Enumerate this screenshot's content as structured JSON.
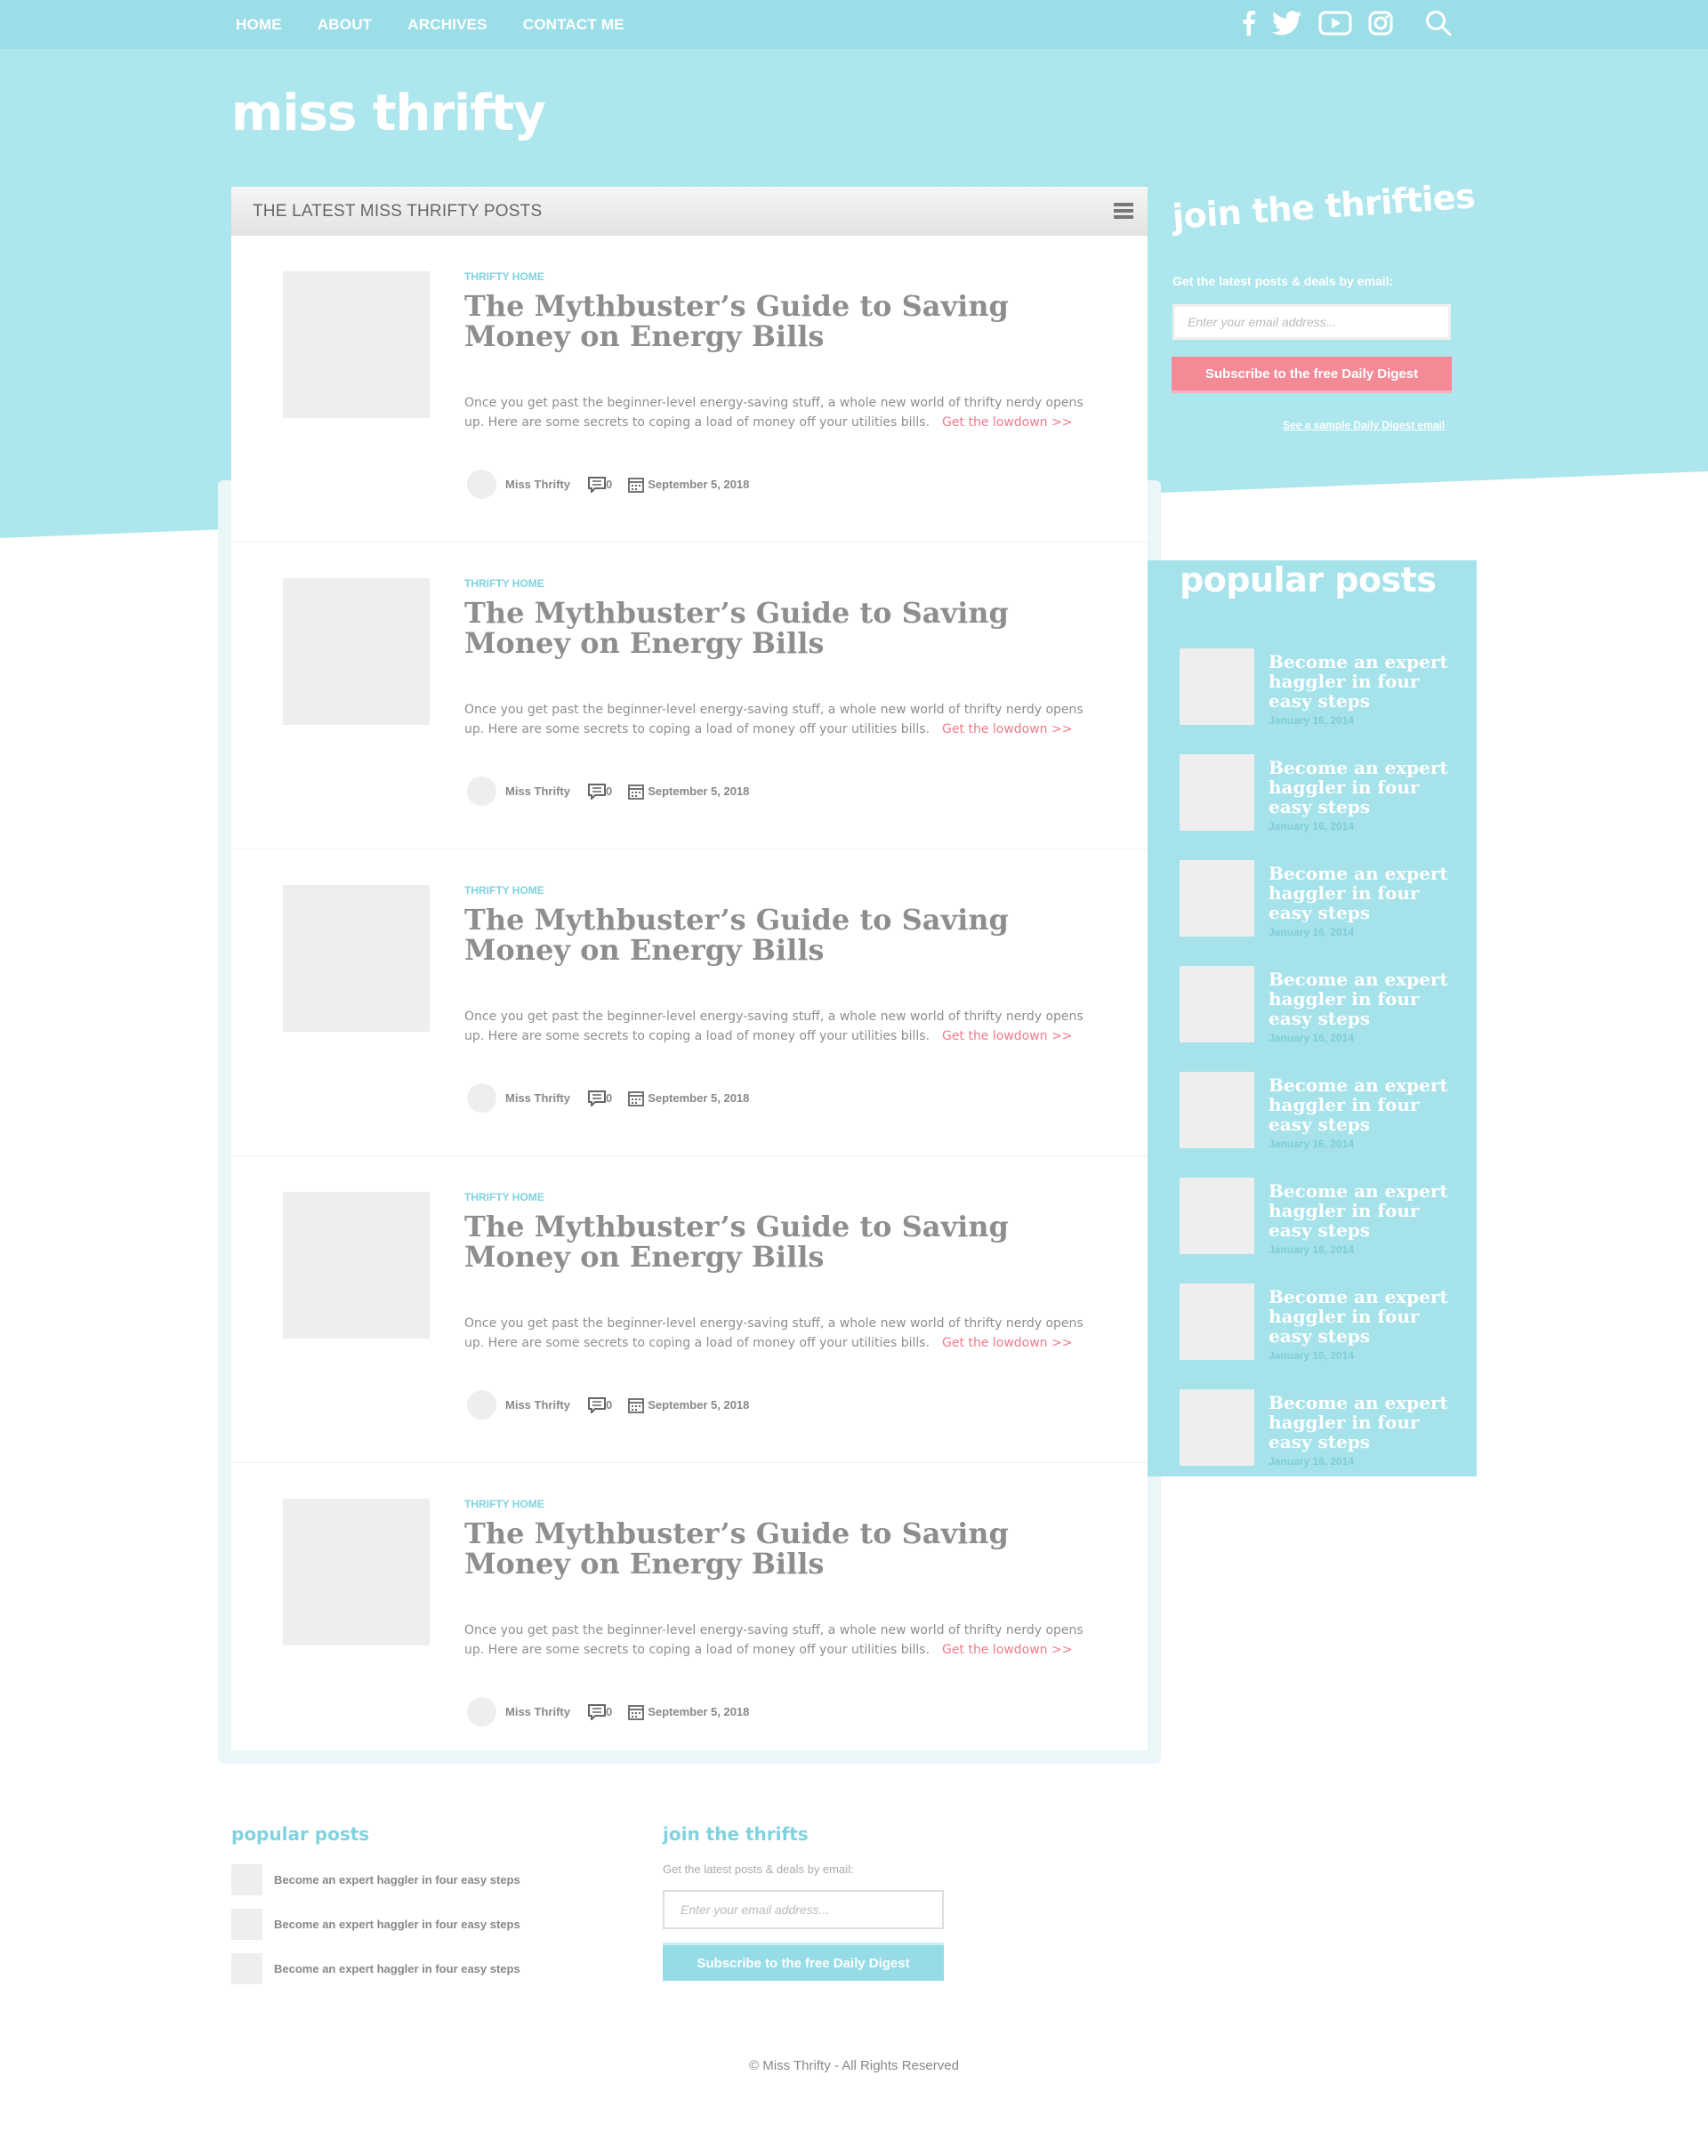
{
  "nav": {
    "items": [
      "HOME",
      "ABOUT",
      "ARCHIVES",
      "CONTACT ME"
    ],
    "social_icons": [
      "facebook-icon",
      "twitter-icon",
      "youtube-icon",
      "instagram-icon"
    ],
    "search_icon": "search-icon"
  },
  "site": {
    "logo": "miss thrifty"
  },
  "colors": {
    "header_bg": "#ade6ed",
    "topbar_bg": "#9cdee8",
    "accent_pink": "#f58a97",
    "accent_teal": "#7fd3df",
    "sidebar_bg": "#a6e2ea"
  },
  "main": {
    "heading": "THE LATEST MISS THRIFTY POSTS",
    "posts": [
      {
        "category": "THRIFTY HOME",
        "title": "The Mythbuster’s Guide to Saving Money on Energy Bills",
        "excerpt": "Once you get past the beginner-level energy-saving stuff, a whole new world of thrifty nerdy opens up. Here are some secrets to coping a load of money off your utilities bills.",
        "more": "Get the lowdown >>",
        "author": "Miss Thrifty",
        "comments": "0",
        "date": "September 5, 2018"
      },
      {
        "category": "THRIFTY HOME",
        "title": "The Mythbuster’s Guide to Saving Money on Energy Bills",
        "excerpt": "Once you get past the beginner-level energy-saving stuff, a whole new world of thrifty nerdy opens up. Here are some secrets to coping a load of money off your utilities bills.",
        "more": "Get the lowdown >>",
        "author": "Miss Thrifty",
        "comments": "0",
        "date": "September 5, 2018"
      },
      {
        "category": "THRIFTY HOME",
        "title": "The Mythbuster’s Guide to Saving Money on Energy Bills",
        "excerpt": "Once you get past the beginner-level energy-saving stuff, a whole new world of thrifty nerdy opens up. Here are some secrets to coping a load of money off your utilities bills.",
        "more": "Get the lowdown >>",
        "author": "Miss Thrifty",
        "comments": "0",
        "date": "September 5, 2018"
      },
      {
        "category": "THRIFTY HOME",
        "title": "The Mythbuster’s Guide to Saving Money on Energy Bills",
        "excerpt": "Once you get past the beginner-level energy-saving stuff, a whole new world of thrifty nerdy opens up. Here are some secrets to coping a load of money off your utilities bills.",
        "more": "Get the lowdown >>",
        "author": "Miss Thrifty",
        "comments": "0",
        "date": "September 5, 2018"
      },
      {
        "category": "THRIFTY HOME",
        "title": "The Mythbuster’s Guide to Saving Money on Energy Bills",
        "excerpt": "Once you get past the beginner-level energy-saving stuff, a whole new world of thrifty nerdy opens up. Here are some secrets to coping a load of money off your utilities bills.",
        "more": "Get the lowdown >>",
        "author": "Miss Thrifty",
        "comments": "0",
        "date": "September 5, 2018"
      }
    ]
  },
  "join": {
    "title": "join the thrifties",
    "subtitle": "Get the latest posts & deals by email:",
    "placeholder": "Enter your email address...",
    "button": "Subscribe to the free Daily Digest",
    "sample_link": "See a sample Daily Digest email"
  },
  "popular": {
    "title": "popular posts",
    "items": [
      {
        "title": "Become an expert haggler in four easy steps",
        "date": "January 16, 2014"
      },
      {
        "title": "Become an expert haggler in four easy steps",
        "date": "January 16, 2014"
      },
      {
        "title": "Become an expert haggler in four easy steps",
        "date": "January 16, 2014"
      },
      {
        "title": "Become an expert haggler in four easy steps",
        "date": "January 16, 2014"
      },
      {
        "title": "Become an expert haggler in four easy steps",
        "date": "January 16, 2014"
      },
      {
        "title": "Become an expert haggler in four easy steps",
        "date": "January 16, 2014"
      },
      {
        "title": "Become an expert haggler in four easy steps",
        "date": "January 16, 2014"
      },
      {
        "title": "Become an expert haggler in four easy steps",
        "date": "January 16, 2014"
      }
    ]
  },
  "footer": {
    "popular_title": "popular posts",
    "popular_items": [
      "Become an expert haggler in four easy steps",
      "Become an expert haggler in four easy steps",
      "Become an expert haggler in four easy steps"
    ],
    "join_title": "join the thrifts",
    "join_subtitle": "Get the latest posts & deals by email:",
    "placeholder": "Enter your email address...",
    "button": "Subscribe to the free Daily Digest",
    "copyright": "© Miss Thrifty - All Rights Reserved"
  }
}
